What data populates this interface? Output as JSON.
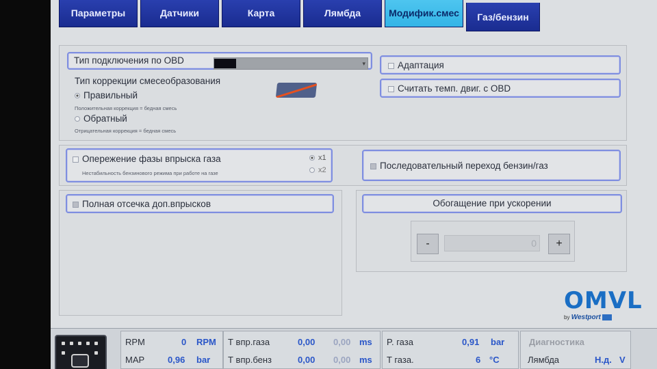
{
  "tabs": [
    {
      "label": "Параметры"
    },
    {
      "label": "Датчики"
    },
    {
      "label": "Карта"
    },
    {
      "label": "Лямбда"
    },
    {
      "label": "Модифик.смес"
    },
    {
      "label": "Газ/бензин"
    }
  ],
  "active_tab": "Модифик.смес",
  "obd": {
    "connection_label": "Тип подключения по OBD",
    "correction_title": "Тип коррекции смесеобразования",
    "option_correct": "Правильный",
    "option_correct_hint": "Положительная коррекция = бедная смесь",
    "option_reverse": "Обратный",
    "option_reverse_hint": "Отрицательная коррекция = бедная смесь",
    "adaptation_label": "Адаптация",
    "read_temp_label": "Считать темп. двиг. с OBD"
  },
  "injection": {
    "advance_label": "Опережение фазы впрыска газа",
    "advance_hint": "Нестабильность бензинового режима при работе на газе",
    "x1": "x1",
    "x2": "x2",
    "sequential_label": "Последовательный переход бензин/газ"
  },
  "cutoff": {
    "full_cutoff_label": "Полная отсечка доп.впрысков"
  },
  "enrichment": {
    "title": "Обогащение при ускорении",
    "minus": "-",
    "plus": "+",
    "value": "0"
  },
  "logo": {
    "brand": "OMVL",
    "by": "by",
    "partner": "Westport"
  },
  "status": {
    "rpm_label": "RPM",
    "rpm_value": "0",
    "rpm_unit": "RPM",
    "map_label": "MAP",
    "map_value": "0,96",
    "map_unit": "bar",
    "t_gas_inj_label": "Т впр.газа",
    "t_gas_inj_value": "0,00",
    "t_gas_inj_value2": "0,00",
    "t_gas_inj_unit": "ms",
    "t_petrol_inj_label": "Т впр.бенз",
    "t_petrol_inj_value": "0,00",
    "t_petrol_inj_value2": "0,00",
    "t_petrol_inj_unit": "ms",
    "p_gas_label": "P. газа",
    "p_gas_value": "0,91",
    "p_gas_unit": "bar",
    "t_gas_label": "T газа.",
    "t_gas_value": "6",
    "t_gas_unit": "°C",
    "diagnostics_label": "Диагностика",
    "lambda_label": "Лямбда",
    "lambda_value": "Н.д.",
    "lambda_unit": "V"
  }
}
